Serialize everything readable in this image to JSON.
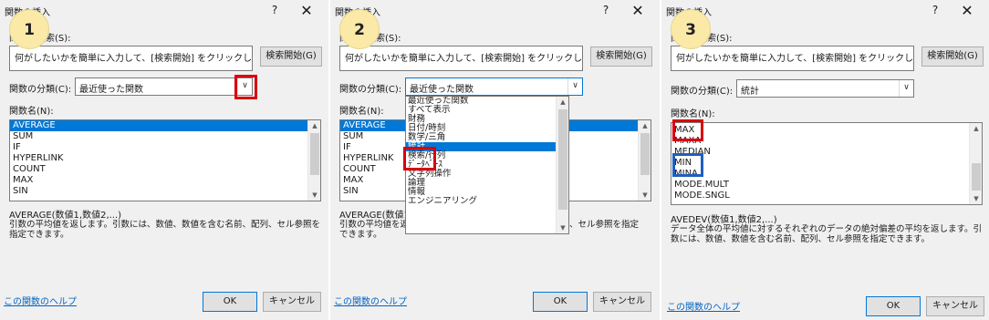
{
  "colors": {
    "accent": "#0078d7",
    "highlight_red": "#d9000f",
    "highlight_blue": "#1f5fbf",
    "badge": "#fbe9a8",
    "link": "#0563c1"
  },
  "dialog": {
    "title": "関数の挿入",
    "help_icon": "?",
    "close_icon": "✕",
    "search_label": "関数の検索(S):",
    "search_value": "何がしたいかを簡単に入力して、[検索開始] をクリックしてください。",
    "search_button": "検索開始(G)",
    "category_label": "関数の分類(C):",
    "function_name_label": "関数名(N):",
    "help_link": "この関数のヘルプ",
    "ok_button": "OK",
    "cancel_button": "キャンセル"
  },
  "panels": [
    {
      "badge": "1",
      "category_value": "最近使った関数",
      "functions": [
        "AVERAGE",
        "SUM",
        "IF",
        "HYPERLINK",
        "COUNT",
        "MAX",
        "SIN"
      ],
      "selected_index": 0,
      "syntax": "AVERAGE(数値1,数値2,...)",
      "description": "引数の平均値を返します。引数には、数値、数値を含む名前、配列、セル参照を指定できます。"
    },
    {
      "badge": "2",
      "category_value": "最近使った関数",
      "functions": [
        "AVERAGE",
        "SUM",
        "IF",
        "HYPERLINK",
        "COUNT",
        "MAX",
        "SIN"
      ],
      "selected_index": 0,
      "syntax": "AVERAGE(数値1",
      "description_line1": "引数の平均値を返",
      "description_line1_tail": "、セル参照を指定",
      "description_line2": "できます。",
      "dropdown_options": [
        "最近使った関数",
        "すべて表示",
        "財務",
        "日付/時刻",
        "数学/三角",
        "統計",
        "検索/行列",
        "ﾃﾞｰﾀﾍﾞｰｽ",
        "文字列操作",
        "論理",
        "情報",
        "エンジニアリング"
      ],
      "dropdown_selected": 5
    },
    {
      "badge": "3",
      "category_value": "統計",
      "functions": [
        "MAX",
        "MAXA",
        "MEDIAN",
        "MIN",
        "MINA",
        "MODE.MULT",
        "MODE.SNGL"
      ],
      "selected_index": -1,
      "syntax": "AVEDEV(数値1,数値2,...)",
      "description": "データ全体の平均値に対するそれぞれのデータの絶対偏差の平均を返します。引数には、数値、数値を含む名前、配列、セル参照を指定できます。"
    }
  ]
}
